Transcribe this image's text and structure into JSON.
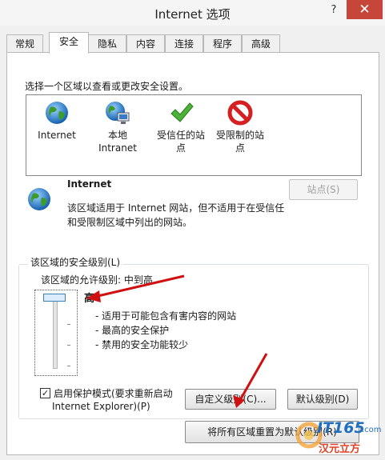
{
  "window": {
    "title": "Internet 选项",
    "help": "?",
    "close": "✕"
  },
  "tabs": [
    {
      "label": "常规"
    },
    {
      "label": "安全"
    },
    {
      "label": "隐私"
    },
    {
      "label": "内容"
    },
    {
      "label": "连接"
    },
    {
      "label": "程序"
    },
    {
      "label": "高级"
    }
  ],
  "security": {
    "instruction": "选择一个区域以查看或更改安全设置。",
    "zones": [
      {
        "line1": "Internet",
        "line2": "",
        "icon": "globe-icon"
      },
      {
        "line1": "本地",
        "line2": "Intranet",
        "icon": "local-intranet-icon"
      },
      {
        "line1": "受信任的站",
        "line2": "点",
        "icon": "green-check-icon"
      },
      {
        "line1": "受限制的站",
        "line2": "点",
        "icon": "red-forbidden-icon"
      }
    ],
    "selected_zone": {
      "name": "Internet",
      "desc1": "该区域适用于 Internet 网站，但不适用于在受信任",
      "desc2": "和受限制区域中列出的网站。"
    },
    "sites_button": "站点(S)",
    "level_group": "该区域的安全级别(L)",
    "allowed_level": "该区域的允许级别: 中到高",
    "level": "高",
    "bullets": [
      "- 适用于可能包含有害内容的网站",
      "- 最高的安全保护",
      "- 禁用的安全功能较少"
    ],
    "protected_mode_line1": "启用保护模式(要求重新启动",
    "protected_mode_line2": "Internet Explorer)(P)",
    "protected_mode_checked": true,
    "custom_level_button": "自定义级别(C)...",
    "default_level_button": "默认级别(D)",
    "reset_all_button": "将所有区域重置为默认级别(R)"
  },
  "watermark": {
    "logo": "IT165",
    "domain": ".com",
    "tagline": "汉元立方"
  },
  "colors": {
    "close": "#c7463a",
    "arrow": "#d01010",
    "accent": "#3c7fb1"
  }
}
